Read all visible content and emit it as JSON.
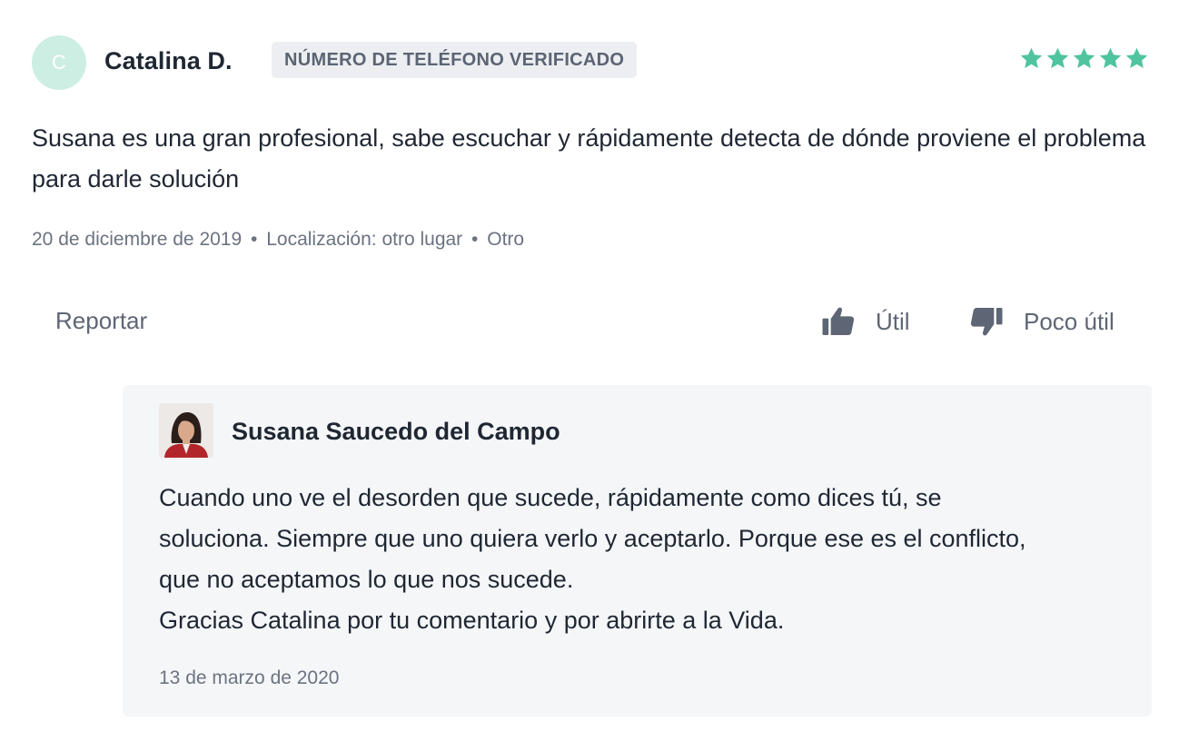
{
  "review": {
    "avatar_initial": "C",
    "author": "Catalina D.",
    "badge": "NÚMERO DE TELÉFONO VERIFICADO",
    "rating": 5,
    "rating_max": 5,
    "star_color": "#4fc49e",
    "text": "Susana es una gran profesional, sabe escuchar y rápidamente detecta de dónde proviene el problema para darle solución",
    "date": "20 de diciembre de 2019",
    "location": "Localización: otro lugar",
    "category": "Otro",
    "separator": "•"
  },
  "actions": {
    "report_label": "Reportar",
    "useful_label": "Útil",
    "not_useful_label": "Poco útil",
    "useful_icon": "thumbs-up-icon",
    "not_useful_icon": "thumbs-down-icon"
  },
  "reply": {
    "author": "Susana Saucedo del Campo",
    "lines": [
      "Cuando uno ve el desorden que sucede, rápidamente como dices tú, se",
      "soluciona. Siempre que uno quiera verlo y aceptarlo. Porque ese es el conflicto,",
      "que no aceptamos lo que nos sucede.",
      "Gracias Catalina por tu comentario y por abrirte a la Vida."
    ],
    "date": "13 de marzo de 2020"
  }
}
